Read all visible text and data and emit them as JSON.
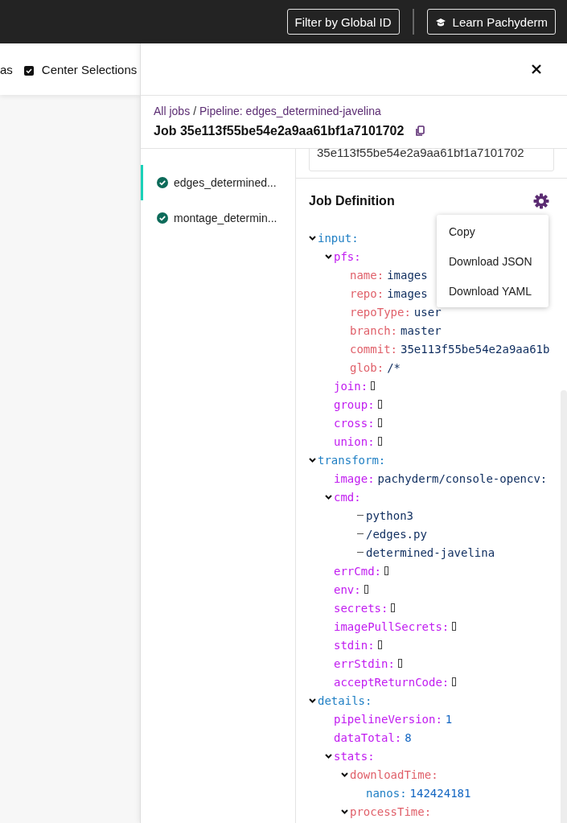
{
  "top_bar": {
    "buttons": [
      {
        "kind": "plain",
        "label": "Filter by Global ID"
      },
      {
        "kind": "learn",
        "label": "Learn Pachyderm"
      }
    ]
  },
  "canvas_toolbar": {
    "items": [
      {
        "kind": "text",
        "label": "as"
      },
      {
        "kind": "checkbox",
        "label": "Center Selections",
        "checked": true
      }
    ]
  },
  "panel": {
    "breadcrumb": [
      {
        "kind": "link",
        "label": "All jobs"
      },
      {
        "kind": "separator",
        "label": "/"
      },
      {
        "kind": "link",
        "label": "Pipeline: edges_determined-javelina"
      }
    ],
    "title": "Job 35e113f55be54e2a9aa61bf1a7101702",
    "jobs": [
      {
        "label": "edges_determined...",
        "selected": true
      },
      {
        "label": "montage_determin...",
        "selected": false
      }
    ],
    "id_field": {
      "value": "35e113f55be54e2a9aa61bf1a7101702"
    },
    "job_definition": {
      "title": "Job Definition",
      "menu": {
        "open": true,
        "items": [
          "Copy",
          "Download JSON",
          "Download YAML"
        ]
      },
      "tree": [
        {
          "key": "input:",
          "expanded": true,
          "children": [
            {
              "key": "pfs:",
              "expanded": true,
              "children": [
                {
                  "key": "name:",
                  "kind": "string",
                  "value": "images"
                },
                {
                  "key": "repo:",
                  "kind": "string",
                  "value": "images"
                },
                {
                  "key": "repoType:",
                  "kind": "string",
                  "value": "user"
                },
                {
                  "key": "branch:",
                  "kind": "string",
                  "value": "master"
                },
                {
                  "key": "commit:",
                  "kind": "string",
                  "value": "35e113f55be54e2a9aa61b"
                },
                {
                  "key": "glob:",
                  "kind": "string",
                  "value": "/*"
                }
              ]
            },
            {
              "key": "join:",
              "kind": "empty"
            },
            {
              "key": "group:",
              "kind": "empty"
            },
            {
              "key": "cross:",
              "kind": "empty"
            },
            {
              "key": "union:",
              "kind": "empty"
            }
          ]
        },
        {
          "key": "transform:",
          "expanded": true,
          "children": [
            {
              "key": "image:",
              "kind": "string",
              "value": "pachyderm/console-opencv:"
            },
            {
              "key": "cmd:",
              "expanded": true,
              "children": [
                {
                  "kind": "item",
                  "value": "python3"
                },
                {
                  "kind": "item",
                  "value": "/edges.py"
                },
                {
                  "kind": "item",
                  "value": "determined-javelina"
                }
              ]
            },
            {
              "key": "errCmd:",
              "kind": "empty"
            },
            {
              "key": "env:",
              "kind": "empty"
            },
            {
              "key": "secrets:",
              "kind": "empty"
            },
            {
              "key": "imagePullSecrets:",
              "kind": "empty"
            },
            {
              "key": "stdin:",
              "kind": "empty"
            },
            {
              "key": "errStdin:",
              "kind": "empty"
            },
            {
              "key": "acceptReturnCode:",
              "kind": "empty"
            }
          ]
        },
        {
          "key": "details:",
          "expanded": true,
          "children": [
            {
              "key": "pipelineVersion:",
              "kind": "number",
              "value": "1"
            },
            {
              "key": "dataTotal:",
              "kind": "number",
              "value": "8"
            },
            {
              "key": "stats:",
              "expanded": true,
              "children": [
                {
                  "key": "downloadTime:",
                  "expanded": true,
                  "children": [
                    {
                      "key": "nanos:",
                      "kind": "number",
                      "value": "142424181"
                    }
                  ]
                },
                {
                  "key": "processTime:",
                  "expanded": true
                }
              ]
            }
          ]
        }
      ]
    }
  }
}
